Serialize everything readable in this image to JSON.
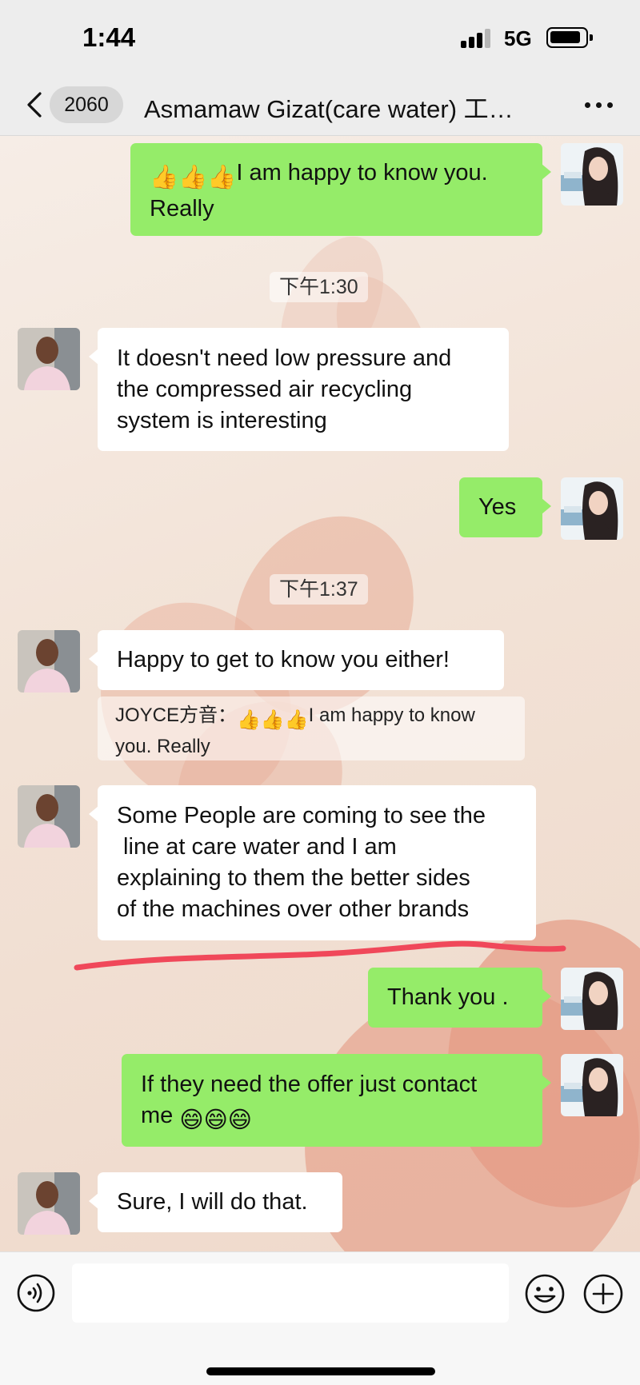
{
  "status_bar": {
    "time": "1:44",
    "network": "5G"
  },
  "header": {
    "unread_count": "2060",
    "chat_title": "Asmamaw Gizat(care water) 工…"
  },
  "messages": [
    {
      "from": "me",
      "lines": [
        "I am happy to know you.",
        "Really"
      ],
      "emojis_before": "👍👍👍"
    },
    {
      "timestamp": "下午1:30"
    },
    {
      "from": "contact",
      "lines": [
        "It doesn't need low pressure and",
        "the compressed air recycling",
        "system is interesting"
      ]
    },
    {
      "from": "me",
      "lines": [
        "Yes"
      ]
    },
    {
      "timestamp": "下午1:37"
    },
    {
      "from": "contact",
      "lines": [
        "Happy to get to know you either!"
      ]
    },
    {
      "quote": {
        "sender": "JOYCE方音：",
        "emojis": "👍👍👍",
        "line1_text": "I am happy to know",
        "line2": "you. Really"
      }
    },
    {
      "from": "contact",
      "lines": [
        "Some People are coming to see the",
        " line at care water and I am",
        "explaining to them the better sides",
        "of the machines over other brands"
      ]
    },
    {
      "from": "me",
      "lines": [
        "Thank you ."
      ]
    },
    {
      "from": "me",
      "lines": [
        "If they need the offer just contact",
        "me "
      ],
      "emojis_after": "😄😄😄"
    },
    {
      "from": "contact",
      "lines": [
        "Sure, I will do that."
      ]
    }
  ],
  "colors": {
    "outgoing_bubble": "#95ec69",
    "incoming_bubble": "#ffffff",
    "header_bg": "#ededed",
    "underline_mark": "#f0485a"
  },
  "icons": {
    "back": "chevron-left-icon",
    "more": "more-dots-icon",
    "voice": "voice-icon",
    "emoji": "emoji-icon",
    "add": "plus-icon"
  }
}
